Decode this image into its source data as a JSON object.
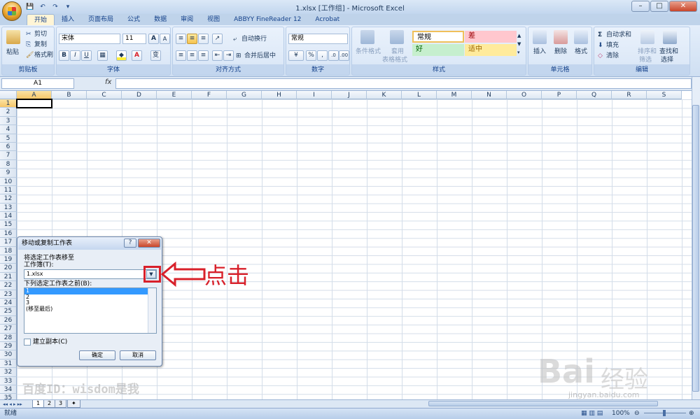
{
  "window": {
    "title": "1.xlsx  [工作组] - Microsoft Excel",
    "minimize": "–",
    "maximize": "□",
    "close": "✕"
  },
  "qat": {
    "save": "💾",
    "undo": "↶",
    "redo": "↷",
    "more": "▾"
  },
  "tabs": [
    "开始",
    "插入",
    "页面布局",
    "公式",
    "数据",
    "审阅",
    "视图",
    "ABBYY FineReader 12",
    "Acrobat"
  ],
  "ribbon": {
    "clipboard": {
      "label": "剪贴板",
      "paste": "粘贴",
      "cut": "剪切",
      "copy": "复制",
      "format_painter": "格式刷"
    },
    "font": {
      "label": "字体",
      "name": "宋体",
      "size": "11",
      "bold": "B",
      "italic": "I",
      "underline": "U",
      "grow": "A",
      "shrink": "A",
      "color_a": "A",
      "wen": "变"
    },
    "alignment": {
      "label": "对齐方式",
      "wrap": "自动换行",
      "merge": "合并后居中"
    },
    "number": {
      "label": "数字",
      "format": "常规",
      "percent": "%",
      "comma": ","
    },
    "styles": {
      "label": "样式",
      "conditional": "条件格式",
      "table": "套用",
      "table2": "表格格式",
      "normal": "常规",
      "bad": "差",
      "good": "好",
      "neutral": "适中"
    },
    "cells": {
      "label": "单元格",
      "insert": "插入",
      "delete": "删除",
      "format": "格式"
    },
    "editing": {
      "label": "编辑",
      "autosum": "自动求和",
      "fill": "填充",
      "clear": "清除",
      "sort": "排序和",
      "sort2": "筛选",
      "find": "查找和",
      "find2": "选择"
    }
  },
  "formula_bar": {
    "name_box": "A1",
    "fx": "fx",
    "value": ""
  },
  "columns": [
    "A",
    "B",
    "C",
    "D",
    "E",
    "F",
    "G",
    "H",
    "I",
    "J",
    "K",
    "L",
    "M",
    "N",
    "O",
    "P",
    "Q",
    "R",
    "S"
  ],
  "rows": [
    "1",
    "2",
    "3",
    "4",
    "5",
    "6",
    "7",
    "8",
    "9",
    "10",
    "11",
    "12",
    "13",
    "14",
    "15",
    "16",
    "17",
    "18",
    "19",
    "20",
    "21",
    "22",
    "23",
    "24",
    "25",
    "26",
    "27",
    "28",
    "29",
    "30",
    "31",
    "32",
    "33",
    "34",
    "35"
  ],
  "sheets": [
    "1",
    "2",
    "3"
  ],
  "status": {
    "ready": "就绪",
    "zoom": "100%",
    "minus": "⊖",
    "plus": "⊕"
  },
  "dialog": {
    "title": "移动或复制工作表",
    "help": "?",
    "close": "✕",
    "move_label": "将选定工作表移至",
    "workbook_label": "工作簿(T):",
    "workbook_value": "1.xlsx",
    "before_label": "下列选定工作表之前(B):",
    "list": [
      "1",
      "2",
      "3",
      "(移至最后)"
    ],
    "copy_label": "建立副本(C)",
    "ok": "确定",
    "cancel": "取消"
  },
  "annotation": {
    "text": "点击"
  },
  "watermarks": {
    "left": "百度ID：wisdom是我",
    "brand": "Bai",
    "brand2": "经验",
    "url": "jingyan.baidu.com"
  },
  "colors": {
    "highlight": "#d8202a",
    "selection": "#3399ff",
    "bad_bg": "#ffc7ce",
    "good_bg": "#c6efce",
    "neutral_bg": "#ffeb9c"
  }
}
